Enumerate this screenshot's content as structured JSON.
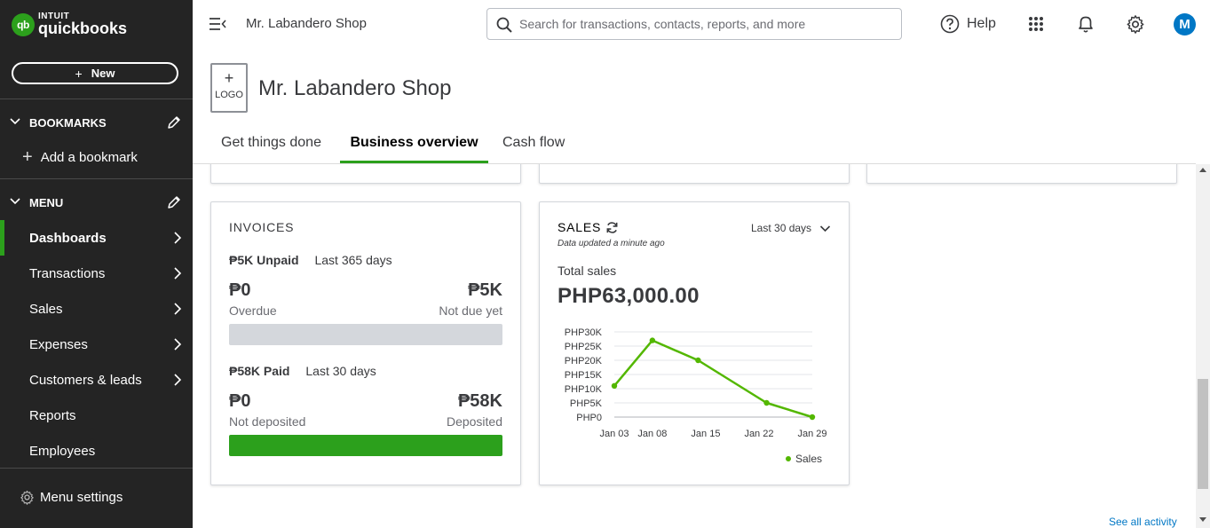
{
  "brand": {
    "line1": "INTUIT",
    "line2": "quickbooks",
    "mark": "qb",
    "color": "#2ca01c"
  },
  "sidebar": {
    "new_label": "New",
    "bookmarks": {
      "title": "BOOKMARKS",
      "add_label": "Add a bookmark"
    },
    "menu": {
      "title": "MENU",
      "items": [
        {
          "label": "Dashboards",
          "has_arrow": true,
          "active": true
        },
        {
          "label": "Transactions",
          "has_arrow": true
        },
        {
          "label": "Sales",
          "has_arrow": true
        },
        {
          "label": "Expenses",
          "has_arrow": true
        },
        {
          "label": "Customers & leads",
          "has_arrow": true
        },
        {
          "label": "Reports",
          "has_arrow": false
        },
        {
          "label": "Employees",
          "has_arrow": false
        }
      ]
    },
    "menu_settings_label": "Menu settings"
  },
  "topbar": {
    "company": "Mr. Labandero Shop",
    "search_placeholder": "Search for transactions, contacts, reports, and more",
    "help_label": "Help",
    "avatar_initial": "M",
    "icons": [
      "hamburger-collapse-icon",
      "search-icon",
      "help-icon",
      "apps-grid-icon",
      "bell-icon",
      "gear-icon"
    ]
  },
  "company_header": {
    "logo_plus": "+",
    "logo_text": "LOGO",
    "name": "Mr. Labandero Shop"
  },
  "tabs": [
    {
      "label": "Get things done"
    },
    {
      "label": "Business overview",
      "active": true
    },
    {
      "label": "Cash flow"
    }
  ],
  "invoices": {
    "title": "INVOICES",
    "unpaid_amount": "₱5K Unpaid",
    "unpaid_period": "Last 365 days",
    "overdue_value": "₱0",
    "overdue_label": "Overdue",
    "not_due_value": "₱5K",
    "not_due_label": "Not due yet",
    "paid_amount": "₱58K Paid",
    "paid_period": "Last 30 days",
    "not_deposited_value": "₱0",
    "not_deposited_label": "Not deposited",
    "deposited_value": "₱58K",
    "deposited_label": "Deposited"
  },
  "sales": {
    "title": "SALES",
    "updated": "Data updated a minute ago",
    "period": "Last 30 days",
    "total_label": "Total sales",
    "total_value": "PHP63,000.00",
    "chart_data": {
      "type": "line",
      "categories": [
        "Jan 03",
        "Jan 08",
        "Jan 15",
        "Jan 22",
        "Jan 29"
      ],
      "x_ticks": [
        "Jan 03",
        "Jan 08",
        "Jan 15",
        "Jan 22",
        "Jan 29"
      ],
      "x": [
        3,
        8,
        15,
        22,
        29
      ],
      "y_ticks": [
        "PHP0",
        "PHP5K",
        "PHP10K",
        "PHP15K",
        "PHP20K",
        "PHP25K",
        "PHP30K"
      ],
      "ylim": [
        0,
        30000
      ],
      "series": [
        {
          "name": "Sales",
          "color": "#53b700",
          "points": [
            {
              "x": 3,
              "y": 11000
            },
            {
              "x": 8,
              "y": 27000
            },
            {
              "x": 14,
              "y": 20000
            },
            {
              "x": 23,
              "y": 5000
            },
            {
              "x": 29,
              "y": 0
            }
          ]
        }
      ],
      "grid": true,
      "legend": "bottom-right"
    }
  },
  "see_all_label": "See all activity"
}
